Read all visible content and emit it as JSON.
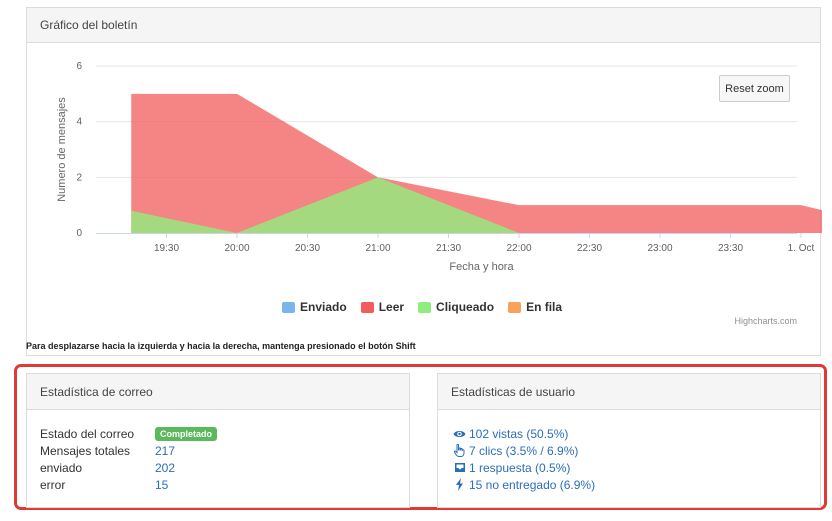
{
  "chart_panel": {
    "title": "Gráfico del boletín",
    "reset_zoom_label": "Reset zoom",
    "credits": "Highcharts.com"
  },
  "chart_data": {
    "type": "area",
    "xlabel": "Fecha y hora",
    "ylabel": "Numero de mensajes",
    "x": [
      "19:15",
      "20:00",
      "21:00",
      "22:00",
      "22:30",
      "23:00",
      "23:30",
      "00:00",
      "00:15"
    ],
    "x_tick_labels": [
      "19:30",
      "20:00",
      "20:30",
      "21:00",
      "21:30",
      "22:00",
      "22:30",
      "23:00",
      "23:30",
      "1. Oct"
    ],
    "ylim": [
      0,
      6
    ],
    "y_ticks": [
      "0",
      "2",
      "4",
      "6"
    ],
    "grid": true,
    "legend_position": "bottom",
    "series": [
      {
        "name": "Enviado",
        "color": "#7cb5ec",
        "values": [
          0,
          0,
          0,
          0,
          0,
          0,
          0,
          0,
          0
        ]
      },
      {
        "name": "Leer",
        "color": "#f15c5c",
        "values": [
          5,
          5,
          2,
          1,
          1,
          1,
          1,
          1,
          0.7
        ]
      },
      {
        "name": "Cliqueado",
        "color": "#90ed7d",
        "values": [
          0.8,
          0,
          2,
          0,
          0,
          0,
          0,
          0,
          0
        ]
      },
      {
        "name": "En fila",
        "color": "#f7a35c",
        "values": [
          0,
          0,
          0,
          0,
          0,
          0,
          0,
          0,
          0
        ]
      }
    ]
  },
  "hint": "Para desplazarse hacia la izquierda y hacia la derecha, mantenga presionado el botón Shift",
  "email_stats": {
    "title": "Estadística de correo",
    "rows": [
      {
        "label": "Estado del correo",
        "value": "Completado"
      },
      {
        "label": "Mensajes totales",
        "value": "217"
      },
      {
        "label": "enviado",
        "value": "202"
      },
      {
        "label": "error",
        "value": "15"
      }
    ]
  },
  "user_stats": {
    "title": "Estadísticas de usuario",
    "rows": [
      {
        "icon": "eye-icon",
        "text": "102 vistas (50.5%)"
      },
      {
        "icon": "pointer-hand-icon",
        "text": "7 clics (3.5% / 6.9%)"
      },
      {
        "icon": "inbox-icon",
        "text": "1 respuesta (0.5%)"
      },
      {
        "icon": "bolt-icon",
        "text": "15 no entregado (6.9%)"
      }
    ]
  }
}
